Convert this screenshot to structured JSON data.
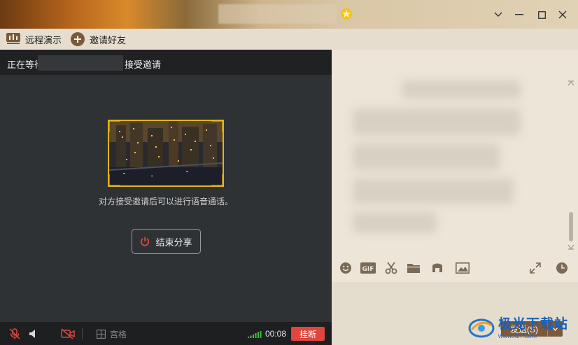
{
  "titlebar": {
    "controls": [
      "collapse",
      "minimize",
      "maximize",
      "close"
    ]
  },
  "toolbar": {
    "remote_demo_label": "远程演示",
    "invite_friend_label": "邀请好友"
  },
  "share": {
    "status_prefix": "正在等待",
    "status_suffix": "接受邀请",
    "hint": "对方接受邀请后可以进行语音通话。",
    "end_share_label": "结束分享"
  },
  "callbar": {
    "grid_label": "宫格",
    "timer": "00:08",
    "hangup_label": "挂断"
  },
  "chat": {
    "send_label": "发送(S)"
  },
  "watermark": {
    "title": "极光下载站",
    "url": "www.xz7.com"
  },
  "colors": {
    "accent_yellow": "#e3b418",
    "hangup_red": "#e0463e",
    "send_brown": "#7b5a3a",
    "dark_panel": "#2f3235"
  }
}
